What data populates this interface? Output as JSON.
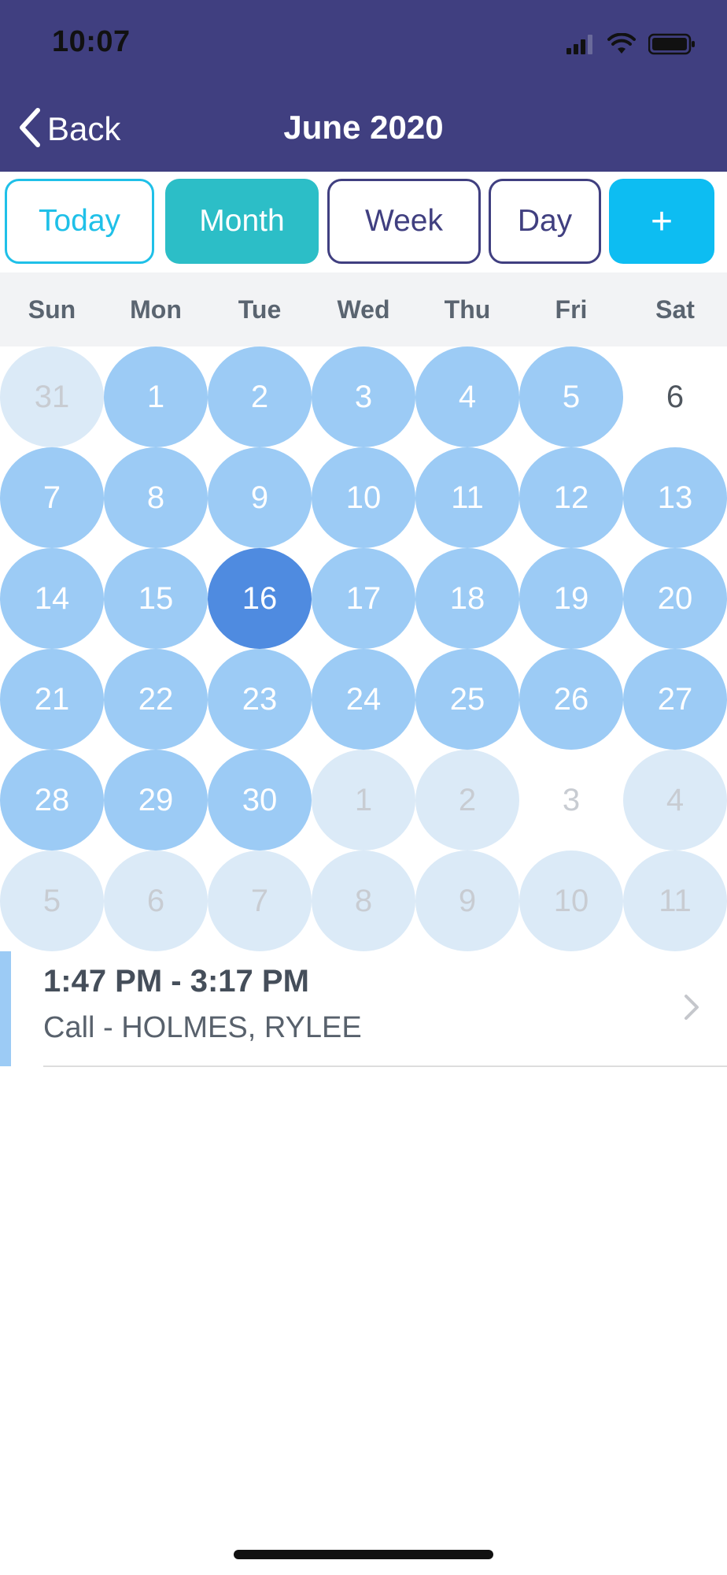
{
  "status_bar": {
    "time": "10:07"
  },
  "header": {
    "back_label": "Back",
    "title": "June 2020"
  },
  "view_tabs": {
    "today": "Today",
    "month": "Month",
    "week": "Week",
    "day": "Day",
    "add": "+"
  },
  "weekdays": [
    "Sun",
    "Mon",
    "Tue",
    "Wed",
    "Thu",
    "Fri",
    "Sat"
  ],
  "weeks": [
    [
      {
        "d": "31",
        "s": "faded"
      },
      {
        "d": "1",
        "s": "active"
      },
      {
        "d": "2",
        "s": "active"
      },
      {
        "d": "3",
        "s": "active"
      },
      {
        "d": "4",
        "s": "active"
      },
      {
        "d": "5",
        "s": "active"
      },
      {
        "d": "6",
        "s": "plain"
      }
    ],
    [
      {
        "d": "7",
        "s": "active"
      },
      {
        "d": "8",
        "s": "active"
      },
      {
        "d": "9",
        "s": "active"
      },
      {
        "d": "10",
        "s": "active"
      },
      {
        "d": "11",
        "s": "active"
      },
      {
        "d": "12",
        "s": "active"
      },
      {
        "d": "13",
        "s": "active"
      }
    ],
    [
      {
        "d": "14",
        "s": "active"
      },
      {
        "d": "15",
        "s": "active"
      },
      {
        "d": "16",
        "s": "selected"
      },
      {
        "d": "17",
        "s": "active"
      },
      {
        "d": "18",
        "s": "active"
      },
      {
        "d": "19",
        "s": "active"
      },
      {
        "d": "20",
        "s": "active"
      }
    ],
    [
      {
        "d": "21",
        "s": "active"
      },
      {
        "d": "22",
        "s": "active"
      },
      {
        "d": "23",
        "s": "active"
      },
      {
        "d": "24",
        "s": "active"
      },
      {
        "d": "25",
        "s": "active"
      },
      {
        "d": "26",
        "s": "active"
      },
      {
        "d": "27",
        "s": "active"
      }
    ],
    [
      {
        "d": "28",
        "s": "active"
      },
      {
        "d": "29",
        "s": "active"
      },
      {
        "d": "30",
        "s": "active"
      },
      {
        "d": "1",
        "s": "faded"
      },
      {
        "d": "2",
        "s": "faded"
      },
      {
        "d": "3",
        "s": "plain-faded"
      },
      {
        "d": "4",
        "s": "faded"
      }
    ],
    [
      {
        "d": "5",
        "s": "faded"
      },
      {
        "d": "6",
        "s": "faded"
      },
      {
        "d": "7",
        "s": "faded"
      },
      {
        "d": "8",
        "s": "faded"
      },
      {
        "d": "9",
        "s": "faded"
      },
      {
        "d": "10",
        "s": "faded"
      },
      {
        "d": "11",
        "s": "faded"
      }
    ]
  ],
  "event": {
    "time": "1:47 PM - 3:17 PM",
    "title": "Call - HOLMES, RYLEE"
  },
  "colors": {
    "header_bg": "#403f80",
    "today_accent": "#1fc0e8",
    "month_active": "#2cbec7",
    "add_button": "#0dbdf2",
    "day_active": "#9ccbf5",
    "day_selected": "#4f8be0",
    "day_faded": "#dbeaf7"
  },
  "icons": {
    "signal": "cellular-signal-icon",
    "wifi": "wifi-icon",
    "battery": "battery-icon",
    "back": "chevron-left-icon",
    "event": "chevron-right-icon"
  }
}
